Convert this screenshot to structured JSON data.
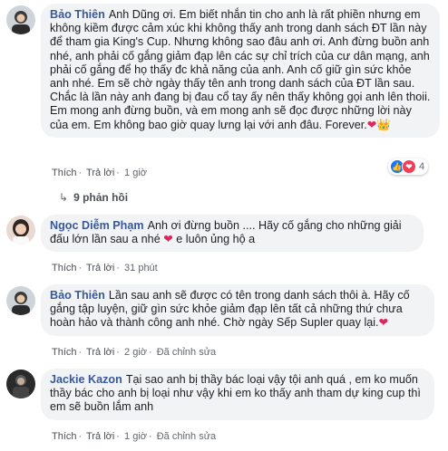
{
  "comments": [
    {
      "author": "Bảo Thiên",
      "text": "Anh Dũng ơi. Em biết nhắn tin cho anh là rất phiền nhưng em không kiềm được cảm xúc khi không thấy anh trong danh sách ĐT lần này để tham gia King's Cup. Nhưng không sao đâu anh ơi. Anh đừng buồn anh nhé, anh phải cố gắng giảm đạp lên các sự chỉ trích của cư dân mạng, anh phải cố gắng để họ thấy đc khả năng của anh. Anh cố giữ gìn sức khỏe anh nhé. Em sẽ chờ ngày thấy tên anh trong danh sách của ĐT lần sau. Chắc là lần này anh đang bị đau cổ tay ấy nên thấy không gọi anh lên thoii. Em mong anh đừng buồn, và em mong anh sẽ đọc được những lời này của em. Em không bao giờ quay lưng lại với anh đâu. Forever.",
      "emoji": "❤👑",
      "like": "Thích",
      "reply": "Trả lời",
      "time": "1 giờ",
      "reaction_count": "4",
      "replies_label": "9 phản hồi"
    },
    {
      "author": "Ngọc Diễm Phạm",
      "text": "Anh ơi đừng buồn .... Hãy cố gắng cho những giải đấu lớn lần sau a nhé",
      "text_after": "e luôn ủng hộ a",
      "emoji": "❤",
      "like": "Thích",
      "reply": "Trả lời",
      "time": "31 phút"
    },
    {
      "author": "Bảo Thiên",
      "text": "Lần sau anh sẽ được có tên trong danh sách thôi à. Hãy cố gắng tập luyện, giữ gìn sức khỏe giảm đạp lên tất cả những thứ chưa hoàn hảo và thành công anh nhé. Chờ ngày Sếp Supler quay lại.",
      "emoji": "❤",
      "like": "Thích",
      "reply": "Trả lời",
      "time": "2 giờ",
      "edited": "Đã chỉnh sửa"
    },
    {
      "author": "Jackie Kazon",
      "text": "Tại sao anh bị thầy bác loại vậy tội anh quá , em ko muốn thầy bác cho anh bị loại như vậy khi em ko thấy anh tham dự king cup thì em sẽ buồn lắm anh",
      "like": "Thích",
      "reply": "Trả lời",
      "time": "1 giờ",
      "edited": "Đã chỉnh sửa"
    }
  ],
  "reactions": [
    "like",
    "love"
  ],
  "colors": {
    "link": "#385898",
    "bubble": "#f2f3f5",
    "heart": "#e0245e"
  }
}
